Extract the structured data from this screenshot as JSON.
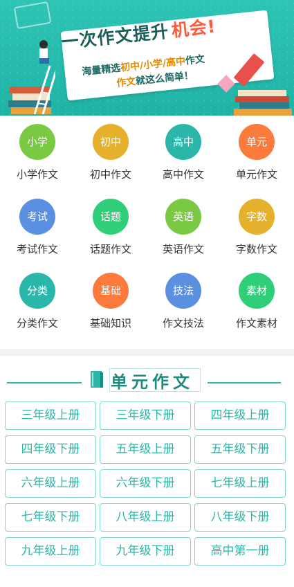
{
  "banner": {
    "title_main": "一次作文提升",
    "title_emph": "机会!",
    "sub1_prefix": "海量精选",
    "sub1_highlight": "初中/小学/高中",
    "sub1_suffix": "作文",
    "sub2_highlight": "作文",
    "sub2_suffix": "就这么简单！"
  },
  "categories": [
    {
      "circle": "小学",
      "label": "小学作文",
      "color": "#7ac943"
    },
    {
      "circle": "初中",
      "label": "初中作文",
      "color": "#e5b12c"
    },
    {
      "circle": "高中",
      "label": "高中作文",
      "color": "#2ab7a9"
    },
    {
      "circle": "单元",
      "label": "单元作文",
      "color": "#fb7a3c"
    },
    {
      "circle": "考试",
      "label": "考试作文",
      "color": "#5b8fe0"
    },
    {
      "circle": "话题",
      "label": "话题作文",
      "color": "#2fcf79"
    },
    {
      "circle": "英语",
      "label": "英语作文",
      "color": "#7ac943"
    },
    {
      "circle": "字数",
      "label": "字数作文",
      "color": "#e5b12c"
    },
    {
      "circle": "分类",
      "label": "分类作文",
      "color": "#2ab7a9"
    },
    {
      "circle": "基础",
      "label": "基础知识",
      "color": "#fb7a3c"
    },
    {
      "circle": "技法",
      "label": "作文技法",
      "color": "#5b8fe0"
    },
    {
      "circle": "素材",
      "label": "作文素材",
      "color": "#2fcf79"
    }
  ],
  "unit_section": {
    "title": "单元作文",
    "grades": [
      "三年级上册",
      "三年级下册",
      "四年级上册",
      "四年级下册",
      "五年级上册",
      "五年级下册",
      "六年级上册",
      "六年级下册",
      "七年级上册",
      "七年级下册",
      "八年级上册",
      "八年级下册",
      "九年级上册",
      "九年级下册",
      "高中第一册"
    ]
  }
}
